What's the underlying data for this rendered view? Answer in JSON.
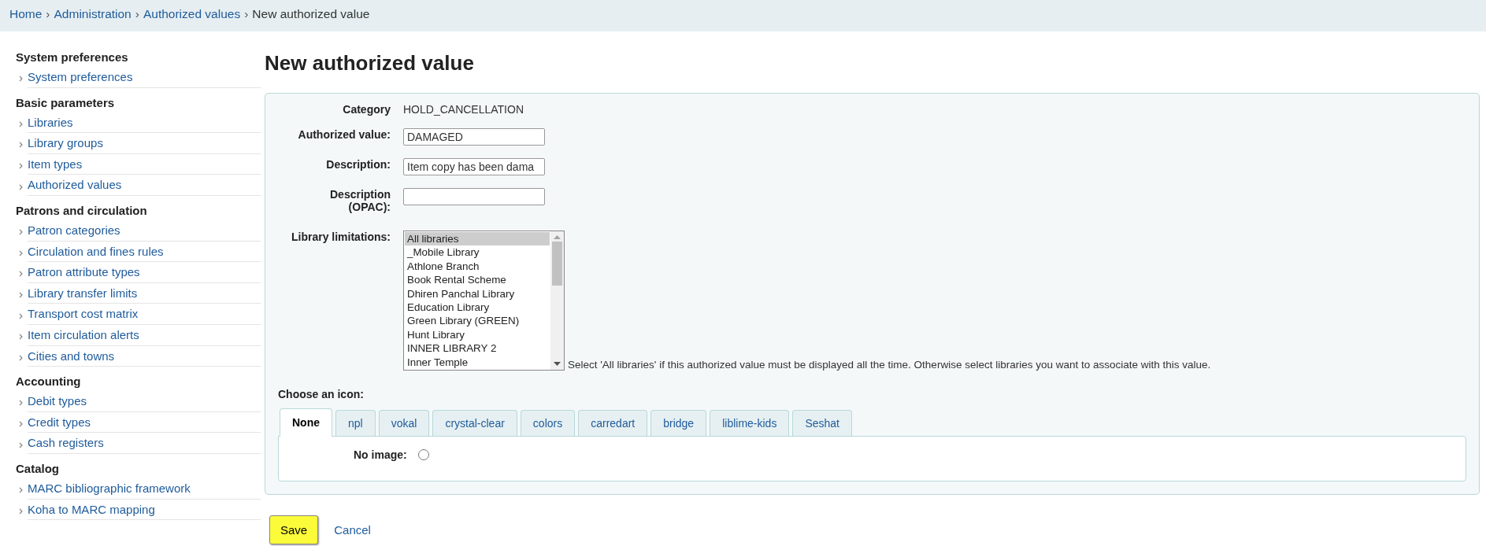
{
  "breadcrumb": {
    "separator": "›",
    "items": [
      {
        "text": "Home",
        "kind": "link"
      },
      {
        "text": "Administration",
        "kind": "link"
      },
      {
        "text": "Authorized values",
        "kind": "link"
      },
      {
        "text": "New authorized value",
        "kind": "current"
      }
    ]
  },
  "sidebar": {
    "sections": [
      {
        "heading": "System preferences",
        "items": [
          "System preferences"
        ]
      },
      {
        "heading": "Basic parameters",
        "items": [
          "Libraries",
          "Library groups",
          "Item types",
          "Authorized values"
        ]
      },
      {
        "heading": "Patrons and circulation",
        "items": [
          "Patron categories",
          "Circulation and fines rules",
          "Patron attribute types",
          "Library transfer limits",
          "Transport cost matrix",
          "Item circulation alerts",
          "Cities and towns"
        ]
      },
      {
        "heading": "Accounting",
        "items": [
          "Debit types",
          "Credit types",
          "Cash registers"
        ]
      },
      {
        "heading": "Catalog",
        "items": [
          "MARC bibliographic framework",
          "Koha to MARC mapping"
        ]
      }
    ]
  },
  "page_title": "New authorized value",
  "form": {
    "category": {
      "label": "Category",
      "value": "HOLD_CANCELLATION"
    },
    "fields": [
      {
        "label": "Authorized value:",
        "value": "DAMAGED"
      },
      {
        "label": "Description:",
        "value": "Item copy has been dama"
      },
      {
        "label": "Description (OPAC):"
      }
    ],
    "library_limitations": {
      "label": "Library limitations:",
      "options": [
        {
          "text": "All libraries",
          "selected": true
        },
        {
          "text": "_Mobile Library",
          "selected": false
        },
        {
          "text": "Athlone Branch",
          "selected": false
        },
        {
          "text": "Book Rental Scheme",
          "selected": false
        },
        {
          "text": "Dhiren Panchal Library",
          "selected": false
        },
        {
          "text": "Education Library",
          "selected": false
        },
        {
          "text": "Green Library (GREEN)",
          "selected": false
        },
        {
          "text": "Hunt Library",
          "selected": false
        },
        {
          "text": "INNER LIBRARY 2",
          "selected": false
        },
        {
          "text": "Inner Temple",
          "selected": false
        }
      ],
      "hint": "Select 'All libraries' if this authorized value must be displayed all the time. Otherwise select libraries you want to associate with this value."
    },
    "icon_chooser": {
      "label": "Choose an icon:",
      "tabs": [
        {
          "label": "None",
          "selected": true
        },
        {
          "label": "npl",
          "selected": false
        },
        {
          "label": "vokal",
          "selected": false
        },
        {
          "label": "crystal-clear",
          "selected": false
        },
        {
          "label": "colors",
          "selected": false
        },
        {
          "label": "carredart",
          "selected": false
        },
        {
          "label": "bridge",
          "selected": false
        },
        {
          "label": "liblime-kids",
          "selected": false
        },
        {
          "label": "Seshat",
          "selected": false
        }
      ],
      "no_image": {
        "label": "No image:",
        "checked": false
      }
    }
  },
  "actions": {
    "save": {
      "label": "Save",
      "highlighted": true
    },
    "cancel": {
      "label": "Cancel"
    }
  }
}
